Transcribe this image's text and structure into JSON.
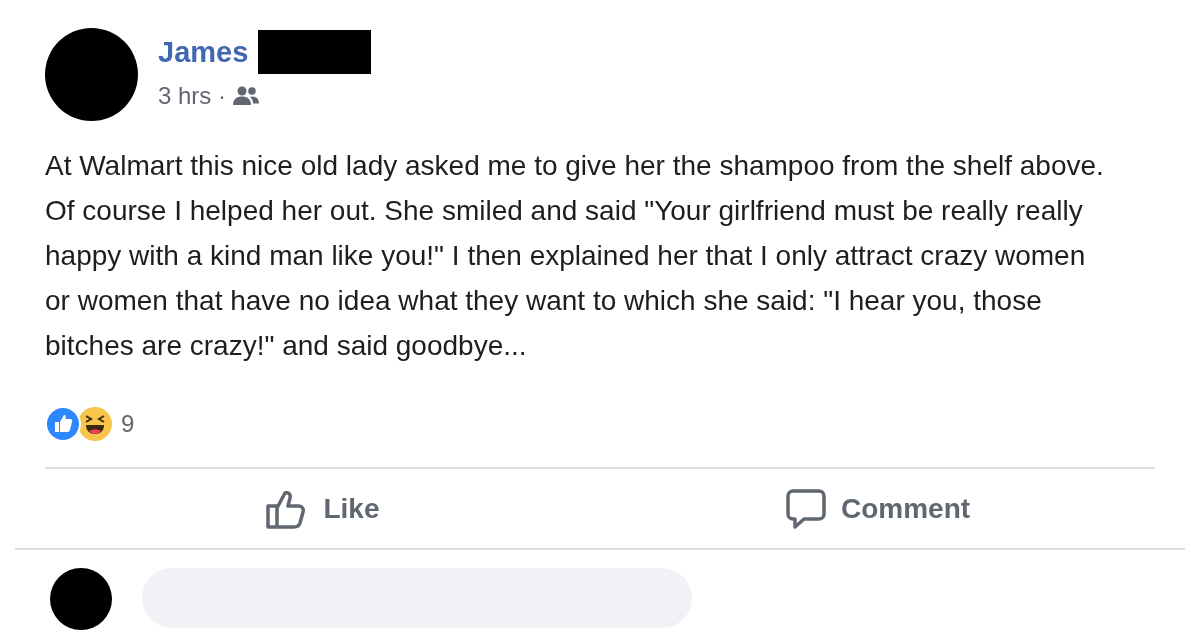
{
  "post": {
    "author": "James",
    "time": "3 hrs ·",
    "text": "At Walmart this nice old lady asked me to give her the shampoo from the shelf above. Of course I helped her out. She smiled and said \"Your girlfriend must be really really happy with a kind man like you!\" I then explained her that I only attract crazy women or women that have no idea what they want to which she said: \"I hear you, those bitches are crazy!\" and said goodbye...",
    "reactions": [
      {
        "kind": "like"
      },
      {
        "kind": "haha"
      }
    ],
    "reaction_count": "9",
    "actions": [
      {
        "kind": "like",
        "label": "Like"
      },
      {
        "kind": "comment",
        "label": "Comment"
      }
    ]
  }
}
